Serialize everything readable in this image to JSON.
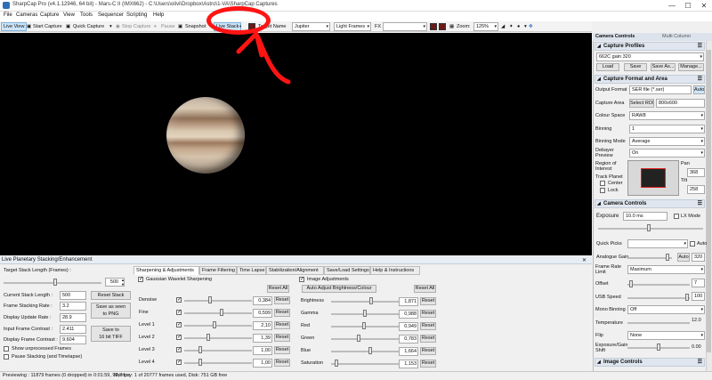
{
  "window": {
    "title": "SharpCap Pro (v4.1.12946, 64 bit) - Mars-C II (IMX662) - C:\\Users\\olivi\\Dropbox\\Astro\\1-VA\\SharpCap Captures",
    "minimize": "—",
    "maximize": "☐",
    "close": "✕"
  },
  "menu": [
    "File",
    "Cameras",
    "Capture",
    "View",
    "Tools",
    "Sequencer",
    "Scripting",
    "Help"
  ],
  "toolbar": {
    "live_view": "Live View",
    "start_capture": "Start Capture",
    "quick_capture": "Quick Capture",
    "stop_capture": "Stop Capture",
    "pause": "Pause",
    "snapshot": "Snapshot",
    "live_stack": "Live Stack",
    "target_name_label": "Target Name",
    "target_name_value": "Jupiter",
    "frame_type": "Light Frames",
    "fx_label": "FX",
    "zoom_label": "Zoom:",
    "zoom_value": "125%"
  },
  "stacking": {
    "header": "Live Planetary Stacking/Enhancement",
    "target_stack_length_label": "Target Stack Length (Frames) :",
    "target_stack_length_value": "500",
    "current_stack_length_label": "Current Stack Length :",
    "current_stack_length_value": "500",
    "reset_stack": "Reset Stack",
    "frame_stacking_rate_label": "Frame Stacking Rate :",
    "frame_stacking_rate_value": "3.2",
    "save_as_seen": "Save as seen\nto PNG",
    "display_update_rate_label": "Display Update Rate :",
    "display_update_rate_value": "28.9",
    "input_frame_contrast_label": "Input Frame Contrast :",
    "input_frame_contrast_value": "2.411",
    "save_tiff": "Save to\n16 bit TIFF",
    "display_frame_contrast_label": "Display Frame Contrast :",
    "display_frame_contrast_value": "9.604",
    "show_unprocessed": "Show unprocessed Frames",
    "pause_stacking": "Pause Stacking (and Timelapse)",
    "tabs": [
      "Sharpening & Adjustments",
      "Frame Filtering",
      "Time Lapse",
      "Stabilization/Alignment",
      "Save/Load Settings",
      "Help & Instructions"
    ],
    "wavelet": {
      "title": "Gaussian Wavelet Sharpening",
      "reset_all": "Reset All",
      "rows": [
        {
          "label": "Denoise",
          "value": "0,384",
          "reset": "Reset",
          "pos": 0.38
        },
        {
          "label": "Fine",
          "value": "0,599",
          "reset": "Reset",
          "pos": 0.55
        },
        {
          "label": "Level 1",
          "value": "2,10",
          "reset": "Reset",
          "pos": 0.45
        },
        {
          "label": "Level 2",
          "value": "1,39",
          "reset": "Reset",
          "pos": 0.35
        },
        {
          "label": "Level 3",
          "value": "1,00",
          "reset": "Reset",
          "pos": 0.22
        },
        {
          "label": "Level 4",
          "value": "1,00",
          "reset": "Reset",
          "pos": 0.22
        }
      ]
    },
    "image_adj": {
      "title": "Image Adjustments",
      "auto_adjust": "Auto Adjust Brightness/Colour",
      "reset_all": "Reset All",
      "rows": [
        {
          "label": "Brightness",
          "value": "1,871",
          "reset": "Reset",
          "pos": 0.6
        },
        {
          "label": "Gamma",
          "value": "0,988",
          "reset": "Reset",
          "pos": 0.5
        },
        {
          "label": "Red",
          "value": "0,949",
          "reset": "Reset",
          "pos": 0.48
        },
        {
          "label": "Green",
          "value": "0,783",
          "reset": "Reset",
          "pos": 0.4
        },
        {
          "label": "Blue",
          "value": "1,664",
          "reset": "Reset",
          "pos": 0.58
        },
        {
          "label": "Saturation",
          "value": "1,153",
          "reset": "Reset",
          "pos": 0.05
        }
      ]
    }
  },
  "status": {
    "preview": "Previewing : 11879 frames (0 dropped) in 0:01:59, 99,7 fps",
    "memory": "Memory: 1 of 20777 frames used, Disk: 751 GB free"
  },
  "right_panel": {
    "tab_camera_controls": "Camera Controls",
    "tab_multi_column": "Multi Column",
    "capture_profiles": {
      "header": "Capture Profiles",
      "profile": "662C gain 320",
      "load": "Load",
      "save": "Save",
      "save_as": "Save As...",
      "manage": "Manage..."
    },
    "format_area": {
      "header": "Capture Format and Area",
      "output_format_label": "Output Format",
      "output_format_value": "SER file (*.ser)",
      "auto": "Auto",
      "capture_area_label": "Capture Area",
      "select_roi": "Select ROI",
      "capture_area_value": "800x600",
      "colour_space_label": "Colour Space",
      "colour_space_value": "RAW8",
      "binning_label": "Binning",
      "binning_value": "1",
      "binning_mode_label": "Binning Mode",
      "binning_mode_value": "Average",
      "debayer_label": "Debayer Preview",
      "debayer_value": "On",
      "roi_label": "Region of Interest",
      "pan_label": "Pan",
      "pan_value": "368",
      "tilt_label": "Tilt",
      "tilt_value": "258",
      "track_planet": "Track Planet",
      "center": "Center",
      "lock": "Lock"
    },
    "camera_controls": {
      "header": "Camera Controls",
      "exposure_label": "Exposure",
      "exposure_value": "10.0 ms",
      "lx_mode": "LX Mode",
      "quick_picks_label": "Quick Picks",
      "auto_qp": "Auto",
      "analogue_gain_label": "Analogue Gain",
      "gain_auto": "Auto",
      "gain_value": "320",
      "frame_rate_label": "Frame Rate Limit",
      "frame_rate_value": "Maximum",
      "offset_label": "Offset",
      "offset_value": "7",
      "usb_speed_label": "USB Speed",
      "usb_speed_value": "100",
      "mono_binning_label": "Mono Binning",
      "mono_binning_value": "Off",
      "temperature_label": "Temperature",
      "temperature_value": "12.0",
      "flip_label": "Flip",
      "flip_value": "None",
      "exposure_gain_shift_label": "Exposure/Gain Shift",
      "exposure_gain_shift_value": "0.00"
    },
    "image_controls": {
      "header": "Image Controls"
    }
  }
}
